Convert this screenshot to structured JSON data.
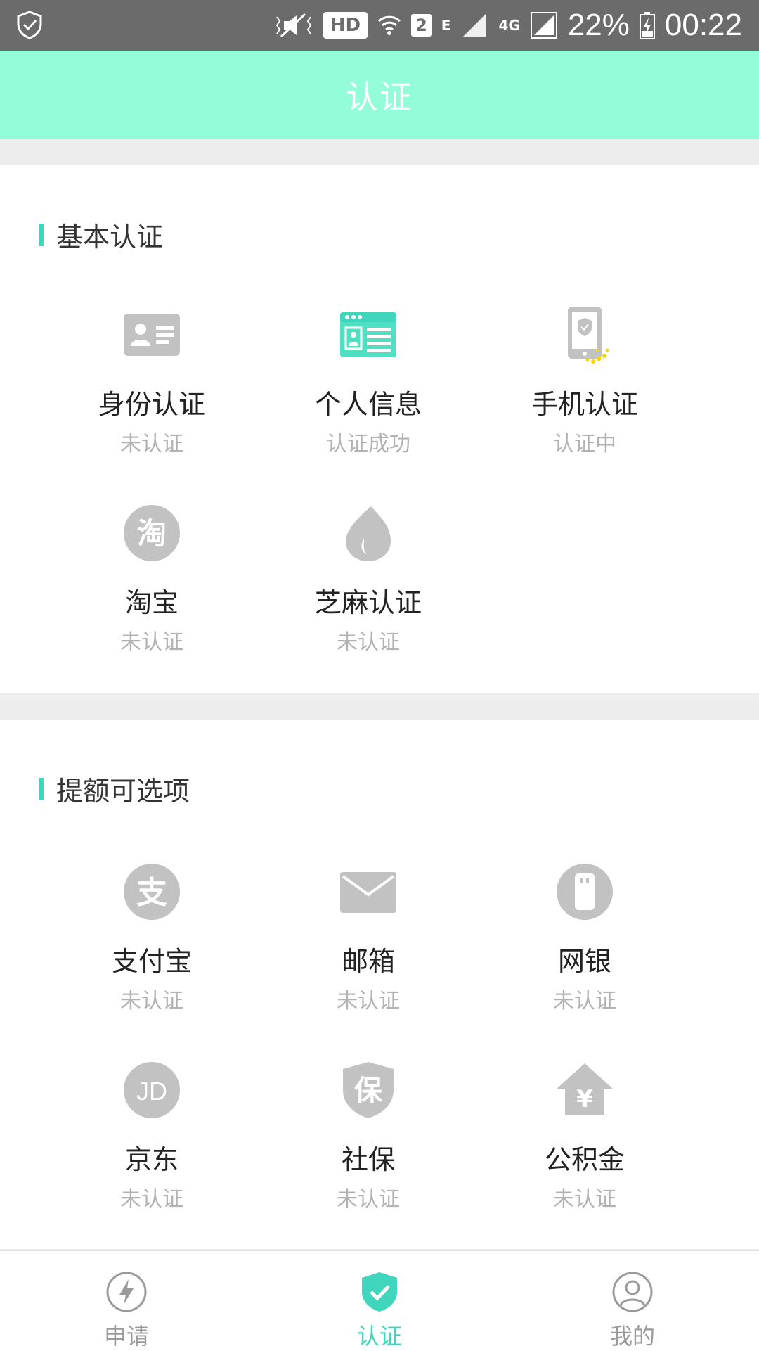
{
  "status_bar": {
    "left_icon": "shield-check-icon",
    "hd": "HD",
    "sim": "2",
    "network_e": "E",
    "network_4g": "4G",
    "battery": "22%",
    "time": "00:22"
  },
  "header": {
    "title": "认证"
  },
  "basic": {
    "title": "基本认证",
    "items": [
      {
        "label": "身份认证",
        "status": "未认证",
        "icon": "id-card-icon"
      },
      {
        "label": "个人信息",
        "status": "认证成功",
        "icon": "personal-info-icon"
      },
      {
        "label": "手机认证",
        "status": "认证中",
        "icon": "phone-shield-icon"
      },
      {
        "label": "淘宝",
        "status": "未认证",
        "icon": "taobao-icon"
      },
      {
        "label": "芝麻认证",
        "status": "未认证",
        "icon": "zhima-icon"
      }
    ]
  },
  "optional": {
    "title": "提额可选项",
    "items": [
      {
        "label": "支付宝",
        "status": "未认证",
        "icon": "alipay-icon"
      },
      {
        "label": "邮箱",
        "status": "未认证",
        "icon": "mail-icon"
      },
      {
        "label": "网银",
        "status": "未认证",
        "icon": "bank-card-icon"
      },
      {
        "label": "京东",
        "status": "未认证",
        "icon": "jd-icon"
      },
      {
        "label": "社保",
        "status": "未认证",
        "icon": "social-security-icon"
      },
      {
        "label": "公积金",
        "status": "未认证",
        "icon": "housing-fund-icon"
      }
    ]
  },
  "nav": {
    "items": [
      {
        "label": "申请",
        "icon": "lightning-icon"
      },
      {
        "label": "认证",
        "icon": "shield-check-icon"
      },
      {
        "label": "我的",
        "icon": "user-icon"
      }
    ],
    "active_index": 1
  },
  "colors": {
    "header_bg": "#93fcd8",
    "accent": "#3fd6bd",
    "icon_gray": "#c2c2c2",
    "status_gray": "#b2b2b2"
  }
}
